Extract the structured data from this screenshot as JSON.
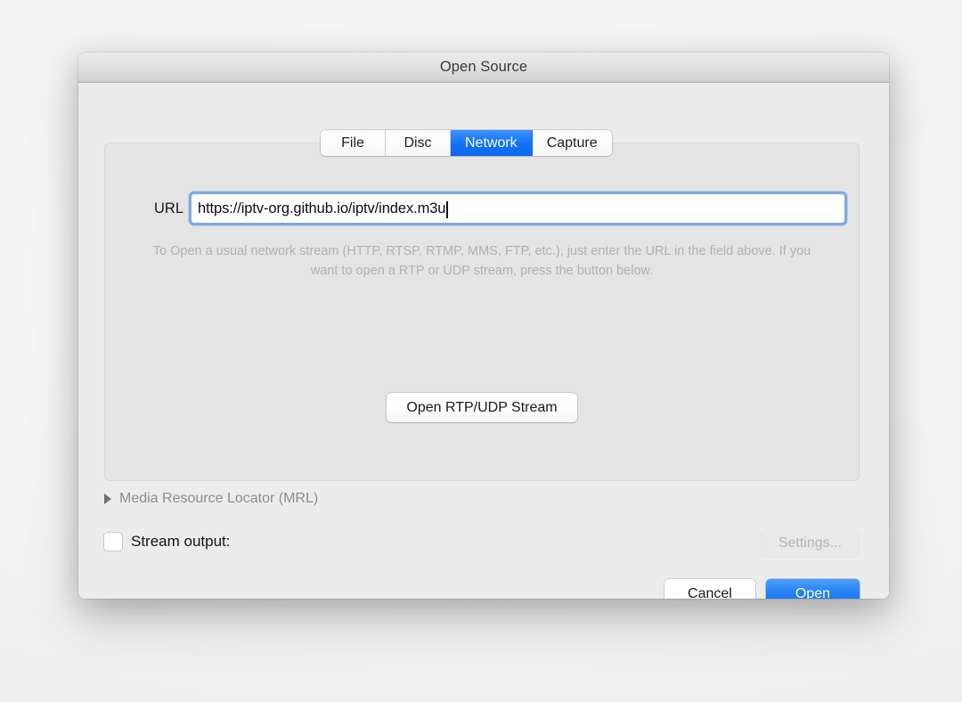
{
  "window": {
    "title": "Open Source"
  },
  "tabs": [
    {
      "label": "File",
      "selected": false
    },
    {
      "label": "Disc",
      "selected": false
    },
    {
      "label": "Network",
      "selected": true
    },
    {
      "label": "Capture",
      "selected": false
    }
  ],
  "network_panel": {
    "url_label": "URL",
    "url_value": "https://iptv-org.github.io/iptv/index.m3u",
    "url_placeholder": "",
    "hint_text": "To Open a usual network stream (HTTP, RTSP, RTMP, MMS, FTP, etc.), just enter the URL in the field above. If you want to open a RTP or UDP stream, press the button below.",
    "rtp_button_label": "Open RTP/UDP Stream"
  },
  "mrl": {
    "label": "Media Resource Locator (MRL)",
    "expanded": false,
    "disclosure_icon": "triangle-right-icon"
  },
  "stream_output": {
    "label": "Stream output:",
    "checked": false,
    "settings_label": "Settings...",
    "settings_enabled": false
  },
  "footer": {
    "cancel_label": "Cancel",
    "open_label": "Open"
  },
  "colors": {
    "accent": "#1472f5",
    "dialog_background": "#ececec",
    "groupbox_background": "#e4e4e4",
    "focus_ring": "#7fa9e2",
    "hint_text": "#b1b1b1",
    "disabled_text": "#b4b4b4"
  }
}
